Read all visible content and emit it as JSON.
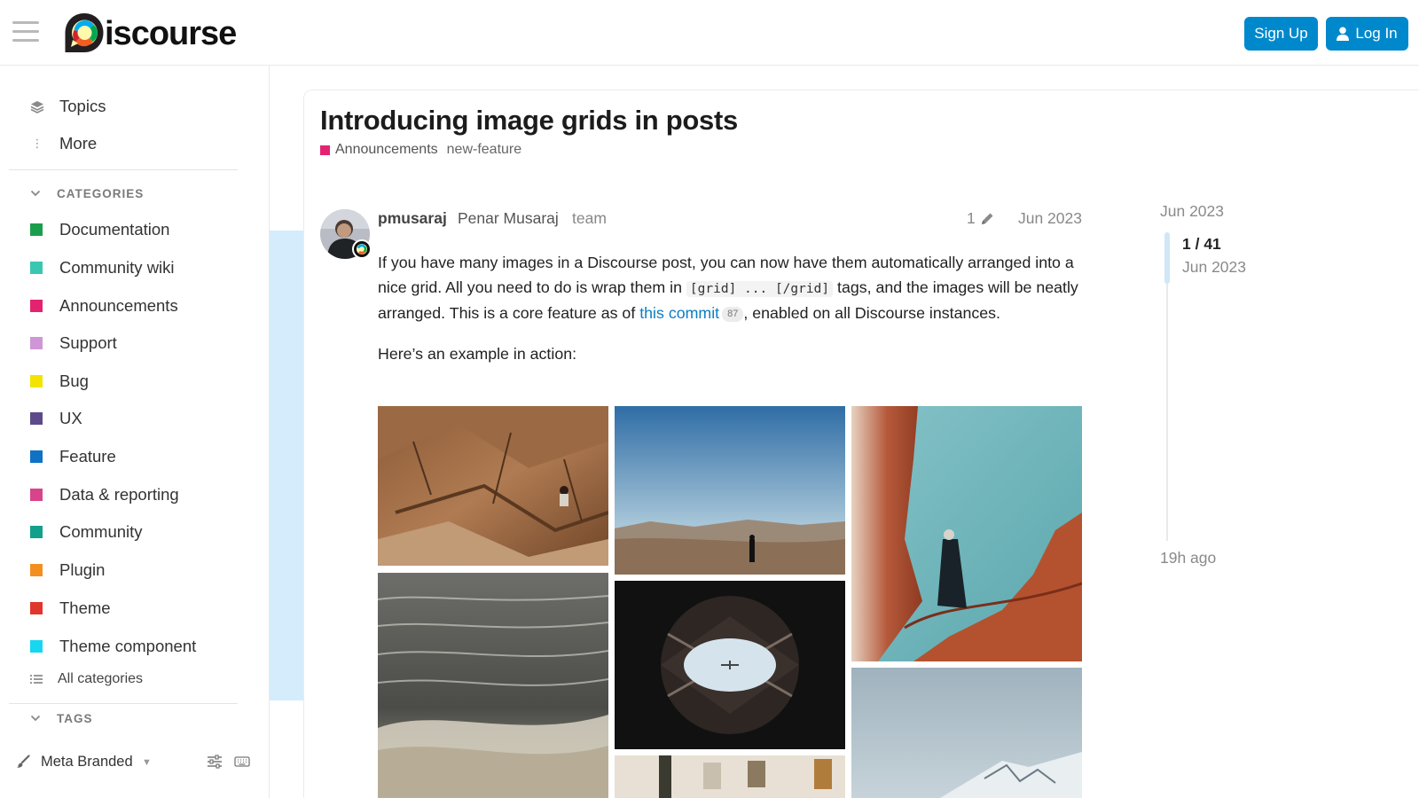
{
  "header": {
    "logo_text": "iscourse",
    "signup_label": "Sign Up",
    "login_label": "Log In",
    "brand_color": "#0088cc"
  },
  "sidebar": {
    "links": [
      {
        "label": "Topics",
        "icon": "layers-icon"
      },
      {
        "label": "More",
        "icon": "vertical-ellipsis-icon"
      }
    ],
    "categories_header": "CATEGORIES",
    "categories": [
      {
        "label": "Documentation",
        "color": "#1b9e4b"
      },
      {
        "label": "Community wiki",
        "color": "#3ac7b2"
      },
      {
        "label": "Announcements",
        "color": "#e3236f"
      },
      {
        "label": "Support",
        "color": "#cf96d6"
      },
      {
        "label": "Bug",
        "color": "#f2e400"
      },
      {
        "label": "UX",
        "color": "#5c4a8a"
      },
      {
        "label": "Feature",
        "color": "#0f72c4"
      },
      {
        "label": "Data & reporting",
        "color": "#d9438c"
      },
      {
        "label": "Community",
        "color": "#12a08c"
      },
      {
        "label": "Plugin",
        "color": "#f48f1f"
      },
      {
        "label": "Theme",
        "color": "#e0362b"
      },
      {
        "label": "Theme component",
        "color": "#17d6f0"
      }
    ],
    "all_categories": "All categories",
    "tags_header": "TAGS",
    "footer": {
      "theme_label": "Meta Branded"
    }
  },
  "topic": {
    "title": "Introducing image grids in posts",
    "category": "Announcements",
    "category_color": "#e3236f",
    "tag": "new-feature"
  },
  "post": {
    "username": "pmusaraj",
    "full_name": "Penar Musaraj",
    "user_title": "team",
    "edits": "1",
    "date": "Jun 2023",
    "p1_a": "If you have many images in a Discourse post, you can now have them automatically arranged into a nice grid. All you need to do is wrap them in ",
    "p1_code": "[grid] ... [/grid]",
    "p1_b": " tags, and the images will be neatly arranged. This is a core feature as of ",
    "p1_link": "this commit",
    "p1_clicks": "87",
    "p1_c": ", enabled on all Discourse instances.",
    "p2": "Here’s an example in action:"
  },
  "timeline": {
    "start": "Jun 2023",
    "position": "1 / 41",
    "position_date": "Jun 2023",
    "end": "19h ago"
  }
}
